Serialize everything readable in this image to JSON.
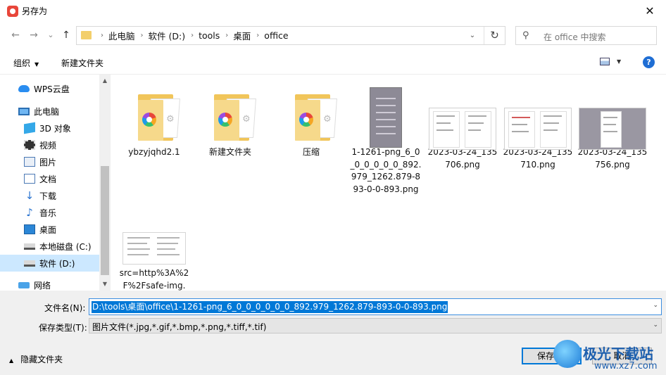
{
  "window": {
    "title": "另存为"
  },
  "nav": {
    "back": "←",
    "forward": "→",
    "history": "⌄",
    "up": "↑"
  },
  "breadcrumbs": [
    "此电脑",
    "软件 (D:)",
    "tools",
    "桌面",
    "office"
  ],
  "search": {
    "placeholder": "在 office 中搜索"
  },
  "toolbar": {
    "organize": "组织",
    "new_folder": "新建文件夹"
  },
  "sidebar": {
    "items": [
      {
        "label": "WPS云盘",
        "icon": "cloud-icon"
      },
      {
        "label": "此电脑",
        "icon": "computer-icon"
      },
      {
        "label": "3D 对象",
        "icon": "3d-objects-icon"
      },
      {
        "label": "视频",
        "icon": "video-icon"
      },
      {
        "label": "图片",
        "icon": "pictures-icon"
      },
      {
        "label": "文档",
        "icon": "documents-icon"
      },
      {
        "label": "下载",
        "icon": "download-icon"
      },
      {
        "label": "音乐",
        "icon": "music-icon"
      },
      {
        "label": "桌面",
        "icon": "desktop-icon"
      },
      {
        "label": "本地磁盘 (C:)",
        "icon": "drive-icon"
      },
      {
        "label": "软件 (D:)",
        "icon": "drive-icon",
        "selected": true
      },
      {
        "label": "网络",
        "icon": "network-icon"
      }
    ]
  },
  "files": [
    {
      "name": "ybzyjqhd2.1",
      "kind": "folder"
    },
    {
      "name": "新建文件夹",
      "kind": "folder"
    },
    {
      "name": "压缩",
      "kind": "folder"
    },
    {
      "name": "1-1261-png_6_0_0_0_0_0_0_892.979_1262.879-893-0-0-893.png",
      "kind": "photo"
    },
    {
      "name": "2023-03-24_135706.png",
      "kind": "document"
    },
    {
      "name": "2023-03-24_135710.png",
      "kind": "document"
    },
    {
      "name": "2023-03-24_135756.png",
      "kind": "document-grey"
    },
    {
      "name": "src=http%3A%2F%2Fsafe-img.",
      "kind": "document-small"
    }
  ],
  "form": {
    "filename_label": "文件名(N):",
    "filename_value": "D:\\tools\\桌面\\office\\1-1261-png_6_0_0_0_0_0_0_892.979_1262.879-893-0-0-893.png",
    "filetype_label": "保存类型(T):",
    "filetype_value": "图片文件(*.jpg,*.gif,*.bmp,*.png,*.tiff,*.tif)"
  },
  "footer": {
    "hide_folders": "隐藏文件夹",
    "save": "保存(S)",
    "cancel": "取消"
  },
  "watermark": {
    "line1": "极光下载站",
    "line2": "www.xz7.com"
  },
  "colors": {
    "accent": "#0078d7",
    "selection": "#cce8ff",
    "folder": "#f1c55a"
  }
}
